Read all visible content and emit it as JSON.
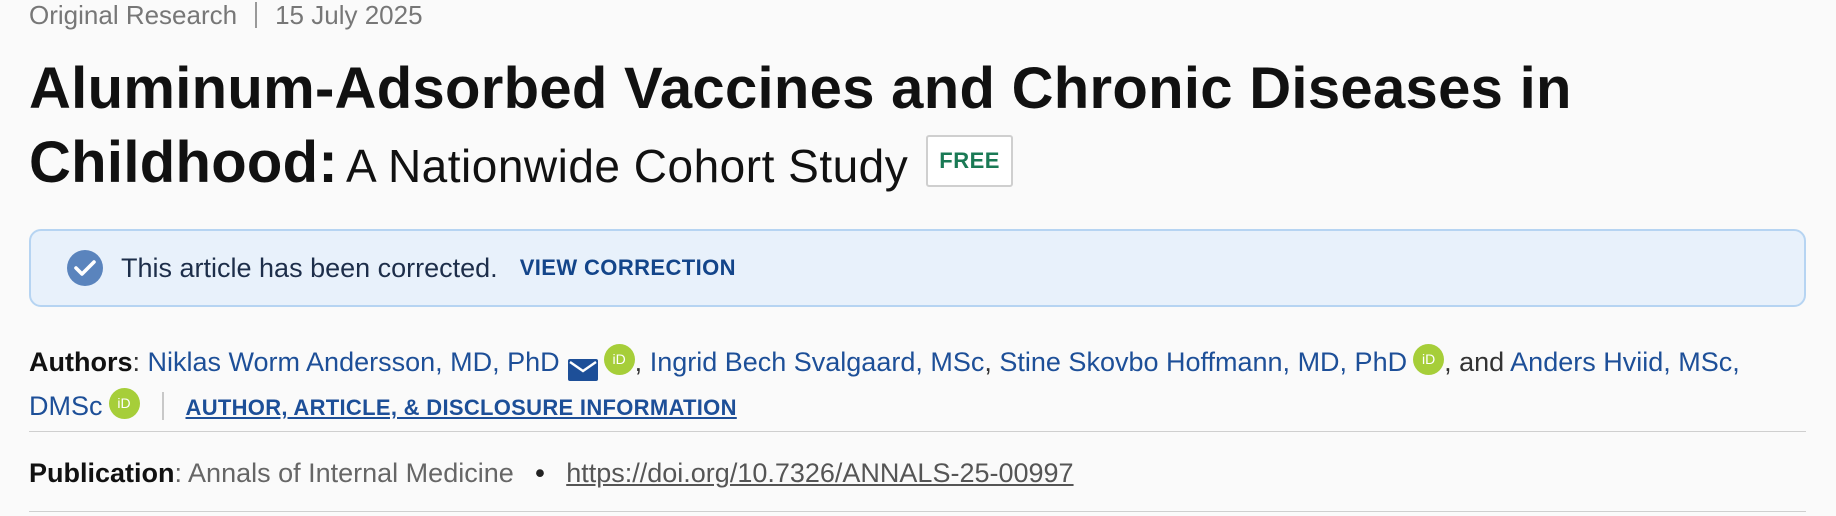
{
  "meta": {
    "article_type": "Original Research",
    "date": "15 July 2025"
  },
  "title": {
    "main": "Aluminum-Adsorbed Vaccines and Chronic Diseases in Childhood:",
    "subtitle": "A Nationwide Cohort Study",
    "badge": "FREE"
  },
  "notice": {
    "icon": "check-circle-icon",
    "text": "This article has been corrected.",
    "link": "VIEW CORRECTION"
  },
  "authors": {
    "label": "Authors",
    "colon": ":",
    "list": [
      "Niklas Worm Andersson, MD, PhD",
      "Ingrid Bech Svalgaard, MSc",
      "Stine Skovbo Hoffmann, MD, PhD",
      "Anders Hviid, MSc, DMSc"
    ],
    "comma": ",",
    "and_text": ", and",
    "orcid_label": "iD",
    "info_link": "AUTHOR, ARTICLE, & DISCLOSURE INFORMATION"
  },
  "publication": {
    "label": "Publication",
    "colon": ":",
    "journal": "Annals of Internal Medicine",
    "bullet": "•",
    "doi": "https://doi.org/10.7326/ANNALS-25-00997"
  },
  "colors": {
    "link_blue": "#1d4f98",
    "free_green": "#1a7a55",
    "orcid_green": "#a6ce39",
    "notice_bg": "#e8f1fb"
  }
}
